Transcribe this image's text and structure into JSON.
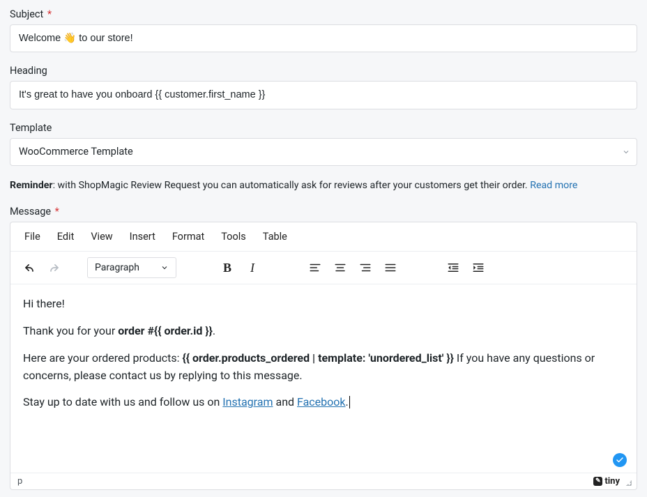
{
  "subject": {
    "label": "Subject",
    "required": "*",
    "value": "Welcome 👋 to our store!"
  },
  "heading": {
    "label": "Heading",
    "value": "It's great to have you onboard {{ customer.first_name }}"
  },
  "template": {
    "label": "Template",
    "value": "WooCommerce Template"
  },
  "reminder": {
    "bold": "Reminder",
    "text": ": with ShopMagic Review Request you can automatically ask for reviews after your customers get their order. ",
    "link": "Read more"
  },
  "message": {
    "label": "Message",
    "required": "*"
  },
  "editor": {
    "menu": {
      "file": "File",
      "edit": "Edit",
      "view": "View",
      "insert": "Insert",
      "format": "Format",
      "tools": "Tools",
      "table": "Table"
    },
    "block_format": "Paragraph",
    "status_path": "p",
    "brand": "tiny"
  },
  "body": {
    "p1": "Hi there!",
    "p2_a": "Thank you for your ",
    "p2_bold": "order #{{ order.id }}",
    "p2_b": ".",
    "p3_a": "Here are your ordered products: ",
    "p3_bold": "{{ order.products_ordered | template: 'unordered_list' }}",
    "p3_b": " If you have any questions or concerns, please contact us by replying to this message.",
    "p4_a": "Stay up to date with us and follow us on ",
    "p4_link1": "Instagram",
    "p4_b": " and ",
    "p4_link2": "Facebook",
    "p4_c": "."
  },
  "icons": {
    "undo": "undo-icon",
    "redo": "redo-icon",
    "bold": "bold-icon",
    "italic": "italic-icon",
    "align_left": "align-left-icon",
    "align_center": "align-center-icon",
    "align_right": "align-right-icon",
    "align_justify": "align-justify-icon",
    "outdent": "outdent-icon",
    "indent": "indent-icon"
  }
}
